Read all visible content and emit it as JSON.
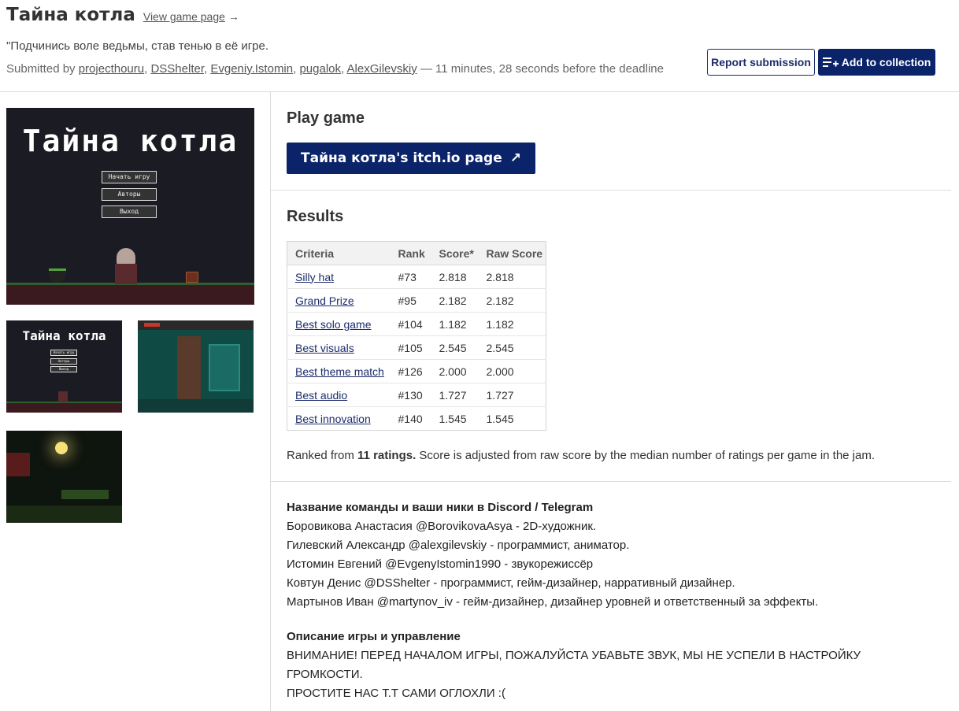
{
  "header": {
    "title": "Тайна котла",
    "view_link": "View game page",
    "view_arrow": "→",
    "tagline": "\"Подчинись воле ведьмы, став тенью в её игре.",
    "submitted_prefix": "Submitted by ",
    "authors": [
      "projecthouru",
      "DSShelter",
      "Evgeniy.Istomin",
      "pugalok",
      "AlexGilevskiy"
    ],
    "separator": ", ",
    "deadline_text": " — 11 minutes, 28 seconds before the deadline",
    "report_label": "Report submission",
    "collection_label": "Add to collection"
  },
  "screenshots": {
    "main_title": "Тайна котла",
    "menu": [
      "Начать игру",
      "Авторы",
      "Выход"
    ]
  },
  "play": {
    "heading": "Play game",
    "button_label": "Тайна котла's itch.io page",
    "button_arrow": "↗"
  },
  "results": {
    "heading": "Results",
    "columns": [
      "Criteria",
      "Rank",
      "Score*",
      "Raw Score"
    ],
    "rows": [
      {
        "criteria": "Silly hat",
        "rank": "#73",
        "score": "2.818",
        "raw": "2.818"
      },
      {
        "criteria": "Grand Prize",
        "rank": "#95",
        "score": "2.182",
        "raw": "2.182"
      },
      {
        "criteria": "Best solo game",
        "rank": "#104",
        "score": "1.182",
        "raw": "1.182"
      },
      {
        "criteria": "Best visuals",
        "rank": "#105",
        "score": "2.545",
        "raw": "2.545"
      },
      {
        "criteria": "Best theme match",
        "rank": "#126",
        "score": "2.000",
        "raw": "2.000"
      },
      {
        "criteria": "Best audio",
        "rank": "#130",
        "score": "1.727",
        "raw": "1.727"
      },
      {
        "criteria": "Best innovation",
        "rank": "#140",
        "score": "1.545",
        "raw": "1.545"
      }
    ],
    "ranked_prefix": "Ranked from ",
    "ranked_count": "11 ratings.",
    "ranked_suffix": " Score is adjusted from raw score by the median number of ratings per game in the jam."
  },
  "description": {
    "team_heading": "Название команды и ваши ники в Discord / Telegram",
    "team_lines": [
      "Боровикова Анастасия @BorovikovaAsya - 2D-художник.",
      "Гилевский Александр @alexgilevskiy - программист, аниматор.",
      "Истомин Евгений @EvgenyIstomin1990 - звукорежиссёр",
      "Ковтун Денис @DSShelter - программист, гейм-дизайнер, нарративный дизайнер.",
      "Мартынов Иван @martynov_iv - гейм-дизайнер, дизайнер уровней и ответственный за эффекты."
    ],
    "game_heading": "Описание игры и управление",
    "game_lines": [
      "ВНИМАНИЕ! ПЕРЕД НАЧАЛОМ ИГРЫ, ПОЖАЛУЙСТА УБАВЬТЕ ЗВУК, МЫ НЕ УСПЕЛИ В НАСТРОЙКУ",
      "ГРОМКОСТИ.",
      "ПРОСТИТЕ НАС Т.Т САМИ ОГЛОХЛИ :("
    ]
  }
}
